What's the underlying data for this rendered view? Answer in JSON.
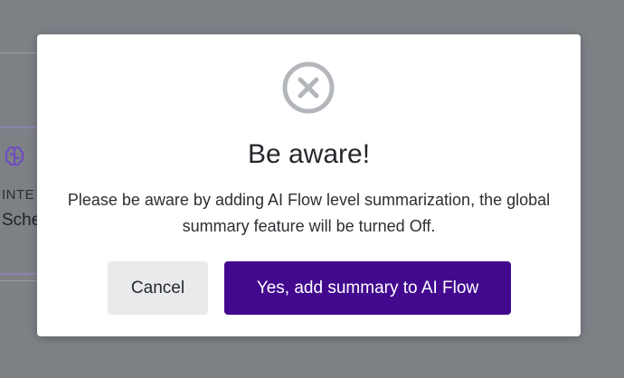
{
  "background": {
    "card_label": "INTE",
    "card_value": "Sche",
    "card_icon": "brain-icon",
    "accent_color": "#7a4fd6"
  },
  "modal": {
    "icon": "close-circle-icon",
    "title": "Be aware!",
    "message": "Please be aware by adding AI Flow level summarization, the global summary feature will be turned Off.",
    "cancel_label": "Cancel",
    "confirm_label": "Yes, add summary to AI Flow",
    "confirm_color": "#42098e"
  }
}
